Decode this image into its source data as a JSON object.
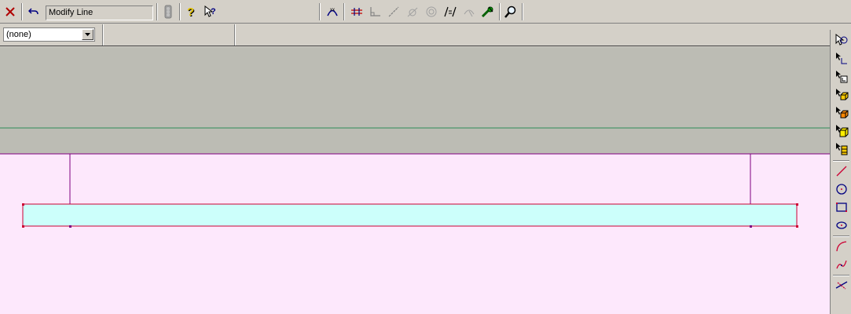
{
  "toolbar": {
    "command_text": "Modify Line",
    "buttons": [
      {
        "name": "close-icon",
        "color": "#b00000"
      },
      {
        "name": "undo-icon"
      },
      {
        "name": "traffic-light-icon"
      },
      {
        "name": "help-icon"
      },
      {
        "name": "whats-this-help-icon"
      },
      {
        "name": "line-endpoints-icon"
      },
      {
        "name": "offset-line-icon"
      },
      {
        "name": "perpendicular-icon"
      },
      {
        "name": "angle-line-icon"
      },
      {
        "name": "tangent-icon"
      },
      {
        "name": "concentric-icon"
      },
      {
        "name": "parallel-icon"
      },
      {
        "name": "arc-lock-icon"
      },
      {
        "name": "smart-dimension-icon"
      },
      {
        "name": "zoom-icon"
      }
    ]
  },
  "layer_select": {
    "value": "(none)"
  },
  "canvas": {
    "top_band_color": "#bcbcb4",
    "bottom_band_color": "#fde8fc",
    "guide_line_color": "#2e8b57",
    "profile_line_color": "#800080",
    "rect_fill": "#ccfffb",
    "rect_stroke": "#cc0033"
  },
  "right_toolbar": [
    {
      "name": "select-icon"
    },
    {
      "name": "corner-icon"
    },
    {
      "name": "dimension-corner-icon"
    },
    {
      "name": "extrude-face-icon"
    },
    {
      "name": "extrude-orange-icon"
    },
    {
      "name": "extrude-yellow-icon"
    },
    {
      "name": "stack-faces-icon"
    },
    {
      "name": "line-tool-icon"
    },
    {
      "name": "circle-tool-icon"
    },
    {
      "name": "rectangle-tool-icon"
    },
    {
      "name": "ellipse-tool-icon"
    },
    {
      "name": "arc-tool-icon"
    },
    {
      "name": "curve-tool-icon"
    },
    {
      "name": "trim-tool-icon"
    }
  ]
}
